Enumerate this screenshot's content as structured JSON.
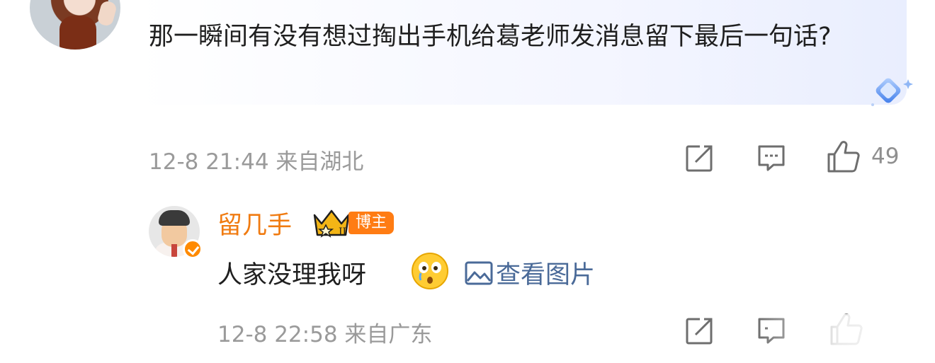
{
  "comment": {
    "text": "那一瞬间有没有想过掏出手机给葛老师发消息留下最后一句话?",
    "time": "12-8 21:44",
    "location": "来自湖北",
    "like_count": "49"
  },
  "reply": {
    "username": "留几手",
    "tag": "博主",
    "text": "人家没理我呀",
    "image_link_label": "查看图片",
    "time": "12-8 22:58",
    "location": "来自广东"
  },
  "colors": {
    "username": "#f07b11",
    "link": "#4a6a98",
    "meta_gray": "#9a9a9a",
    "tag_bg": "#ff7c13"
  },
  "icons": [
    "share-icon",
    "comment-icon",
    "like-icon",
    "image-icon",
    "crown-icon",
    "diamond-badge-icon",
    "verified-icon",
    "astonished-emoji-icon"
  ]
}
